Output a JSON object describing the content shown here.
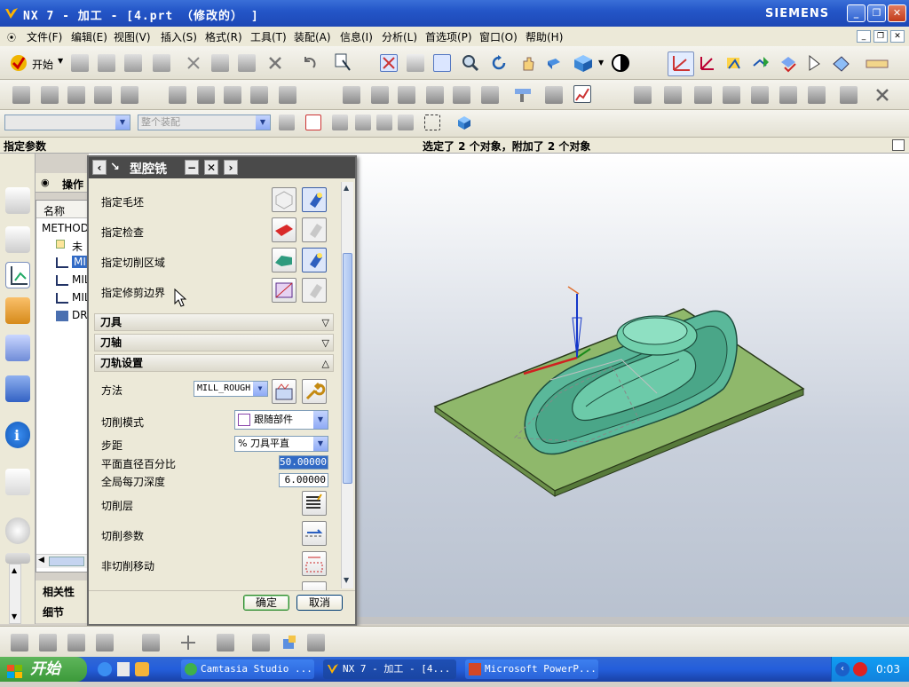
{
  "window": {
    "title": "NX 7 - 加工 - [4.prt （修改的） ]",
    "brand": "SIEMENS"
  },
  "menu": [
    "文件(F)",
    "编辑(E)",
    "视图(V)",
    "插入(S)",
    "格式(R)",
    "工具(T)",
    "装配(A)",
    "信息(I)",
    "分析(L)",
    "首选项(P)",
    "窗口(O)",
    "帮助(H)"
  ],
  "toolbar": {
    "start_label": "开始",
    "assembly_filter": "整个装配"
  },
  "status": {
    "prompt": "指定参数",
    "message": "选定了 2 个对象，附加了 2 个对象"
  },
  "navigator": {
    "title": "操作",
    "column": "名称",
    "rows": [
      "METHOD",
      "未用",
      "MIL",
      "MIL",
      "MIL",
      "DR"
    ],
    "bottom_tabs": [
      "相关性",
      "细节"
    ]
  },
  "dialog": {
    "title": "型腔铣",
    "geometry_rows": [
      "指定毛坯",
      "指定检查",
      "指定切削区域",
      "指定修剪边界"
    ],
    "sections": {
      "tool": "刀具",
      "axis": "刀轴",
      "path": "刀轨设置"
    },
    "path": {
      "method_label": "方法",
      "method_value": "MILL_ROUGH",
      "cut_pattern_label": "切削模式",
      "cut_pattern_value": "跟随部件",
      "stepover_label": "步距",
      "stepover_value": "% 刀具平直",
      "flat_pct_label": "平面直径百分比",
      "flat_pct_value": "50.00000",
      "depth_label": "全局每刀深度",
      "depth_value": "6.00000",
      "cut_levels_label": "切削层",
      "cut_params_label": "切削参数",
      "noncut_label": "非切削移动"
    },
    "ok_label": "确定",
    "cancel_label": "取消"
  },
  "taskbar": {
    "start": "开始",
    "tasks": [
      "Camtasia Studio ...",
      "NX 7 - 加工 - [4...",
      "Microsoft PowerP..."
    ],
    "time": "0:03"
  },
  "colors": {
    "titlebar": "#2456c8",
    "part_green": "#8fb86b",
    "cavity_teal": "#5ab89a",
    "viewport_top": "#ffffff",
    "viewport_bottom": "#b8c1cf"
  }
}
